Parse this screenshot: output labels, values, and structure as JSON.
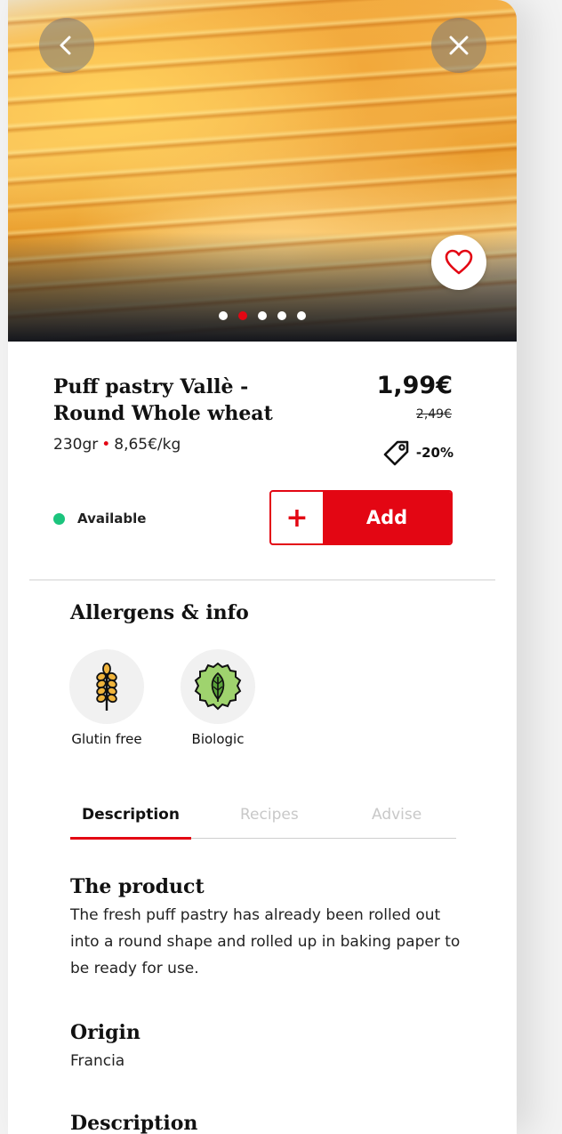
{
  "product": {
    "name": "Puff pastry Vallè - Round Whole wheat",
    "weight": "230gr",
    "unit_price": "8,65€/kg",
    "price": "1,99€",
    "old_price": "2,49€",
    "discount": "-20%",
    "availability": "Available",
    "add_label": "Add",
    "add_plus": "+"
  },
  "gallery": {
    "dot_count": 5,
    "active_dot": 2
  },
  "allergens": {
    "title": "Allergens & info",
    "items": [
      {
        "label": "Glutin free",
        "icon": "wheat-icon"
      },
      {
        "label": "Biologic",
        "icon": "leaf-badge-icon"
      }
    ]
  },
  "tabs": [
    {
      "label": "Description",
      "active": true
    },
    {
      "label": "Recipes",
      "active": false
    },
    {
      "label": "Advise",
      "active": false
    }
  ],
  "sections": {
    "product_title": "The product",
    "product_text": "The fresh puff pastry has already been rolled out into a round shape and rolled up in baking paper to be ready for use.",
    "origin_title": "Origin",
    "origin_text": "Francia",
    "description_title": "Description"
  },
  "colors": {
    "accent": "#e30613",
    "available": "#1bc47d"
  }
}
